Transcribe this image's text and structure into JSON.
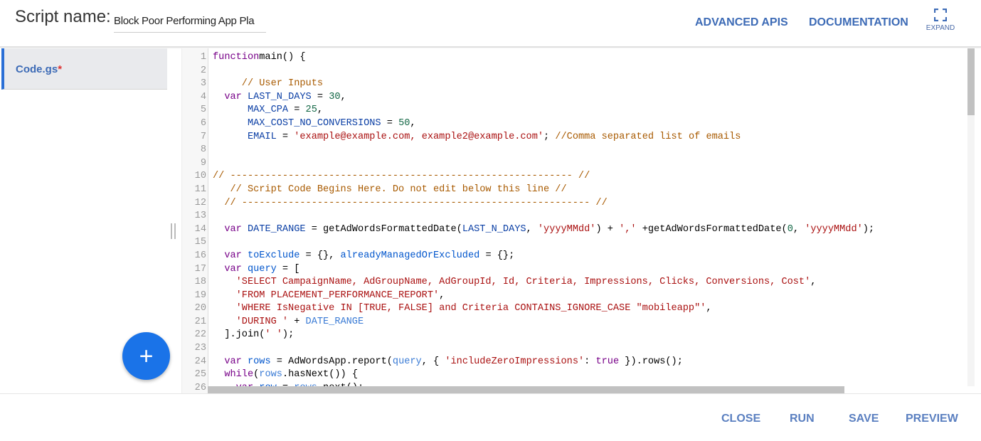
{
  "header": {
    "script_name_label": "Script name:",
    "script_name_value": "Block Poor Performing App Pla",
    "advanced_apis": "ADVANCED APIS",
    "documentation": "DOCUMENTATION",
    "expand": "EXPAND"
  },
  "sidebar": {
    "files": [
      {
        "name": "Code.gs",
        "modified_marker": "*"
      }
    ],
    "add_button": "+"
  },
  "editor": {
    "lines": [
      [
        [
          "k",
          "function"
        ],
        [
          "",
          "main() {"
        ]
      ],
      [],
      [
        [
          "",
          "     "
        ],
        [
          "c",
          "// User Inputs"
        ]
      ],
      [
        [
          "",
          "  "
        ],
        [
          "k",
          "var"
        ],
        [
          "",
          "",
          " "
        ],
        [
          "v",
          " LAST_N_DAYS"
        ],
        [
          "",
          " = "
        ],
        [
          "n",
          "30"
        ],
        [
          "",
          ","
        ]
      ],
      [
        [
          "",
          "      "
        ],
        [
          "v",
          "MAX_CPA"
        ],
        [
          "",
          " = "
        ],
        [
          "n",
          "25"
        ],
        [
          "",
          ","
        ]
      ],
      [
        [
          "",
          "      "
        ],
        [
          "v",
          "MAX_COST_NO_CONVERSIONS"
        ],
        [
          "",
          " = "
        ],
        [
          "n",
          "50"
        ],
        [
          "",
          ","
        ]
      ],
      [
        [
          "",
          "      "
        ],
        [
          "v",
          "EMAIL"
        ],
        [
          "",
          " = "
        ],
        [
          "s",
          "'example@example.com, example2@example.com'"
        ],
        [
          "",
          "; "
        ],
        [
          "c",
          "//Comma separated list of emails"
        ]
      ],
      [],
      [],
      [
        [
          "c",
          "// ----------------------------------------------------------- //"
        ]
      ],
      [
        [
          "",
          "   "
        ],
        [
          "c",
          "// Script Code Begins Here. Do not edit below this line //"
        ]
      ],
      [
        [
          "",
          "  "
        ],
        [
          "c",
          "// ------------------------------------------------------------ //"
        ]
      ],
      [],
      [
        [
          "",
          "  "
        ],
        [
          "k",
          "var"
        ],
        [
          "v",
          " DATE_RANGE"
        ],
        [
          "",
          " = getAdWordsFormattedDate("
        ],
        [
          "v",
          "LAST_N_DAYS"
        ],
        [
          "",
          ", "
        ],
        [
          "s",
          "'yyyyMMdd'"
        ],
        [
          "",
          ") + "
        ],
        [
          "s",
          "','"
        ],
        [
          "",
          "",
          " "
        ],
        [
          "",
          " +getAdWordsFormattedDate("
        ],
        [
          "n",
          "0"
        ],
        [
          "",
          ", "
        ],
        [
          "s",
          "'yyyyMMdd'"
        ],
        [
          "",
          ");"
        ]
      ],
      [],
      [
        [
          "",
          "  "
        ],
        [
          "k",
          "var"
        ],
        [
          "d",
          " toExclude"
        ],
        [
          "",
          " = {}, "
        ],
        [
          "d",
          "alreadyManagedOrExcluded"
        ],
        [
          "",
          " = {};"
        ]
      ],
      [
        [
          "",
          "  "
        ],
        [
          "k",
          "var"
        ],
        [
          "d",
          " query"
        ],
        [
          "",
          " = ["
        ]
      ],
      [
        [
          "",
          "    "
        ],
        [
          "s",
          "'SELECT CampaignName, AdGroupName, AdGroupId, Id, Criteria, Impressions, Clicks, Conversions, Cost'"
        ],
        [
          "",
          ","
        ]
      ],
      [
        [
          "",
          "    "
        ],
        [
          "s",
          "'FROM PLACEMENT_PERFORMANCE_REPORT'"
        ],
        [
          "",
          ","
        ]
      ],
      [
        [
          "",
          "    "
        ],
        [
          "s",
          "'WHERE IsNegative IN [TRUE, FALSE] and Criteria CONTAINS_IGNORE_CASE \"mobileapp\"'"
        ],
        [
          "",
          ","
        ]
      ],
      [
        [
          "",
          "    "
        ],
        [
          "s",
          "'DURING '"
        ],
        [
          "",
          " + "
        ],
        [
          "q",
          "DATE_RANGE"
        ]
      ],
      [
        [
          "",
          "  ].join("
        ],
        [
          "s",
          "' '"
        ],
        [
          "",
          ");"
        ]
      ],
      [],
      [
        [
          "",
          "  "
        ],
        [
          "k",
          "var"
        ],
        [
          "d",
          " rows"
        ],
        [
          "",
          " = AdWordsApp.report("
        ],
        [
          "q",
          "query"
        ],
        [
          "",
          ", { "
        ],
        [
          "s",
          "'includeZeroImpressions'"
        ],
        [
          "",
          ": "
        ],
        [
          "k",
          "true"
        ],
        [
          "",
          " }).rows();"
        ]
      ],
      [
        [
          "",
          "  "
        ],
        [
          "k",
          "while"
        ],
        [
          "",
          "("
        ],
        [
          "q",
          "rows"
        ],
        [
          "",
          ".hasNext()) {"
        ]
      ],
      [
        [
          "",
          "    "
        ],
        [
          "k",
          "var"
        ],
        [
          "d",
          " row"
        ],
        [
          "",
          " = "
        ],
        [
          "q",
          "rows"
        ],
        [
          "",
          ".next();"
        ]
      ]
    ]
  },
  "footer": {
    "close": "CLOSE",
    "run": "RUN",
    "save": "SAVE",
    "preview": "PREVIEW"
  },
  "colors": {
    "accent": "#1a73e8",
    "link": "#3d6bb6"
  }
}
